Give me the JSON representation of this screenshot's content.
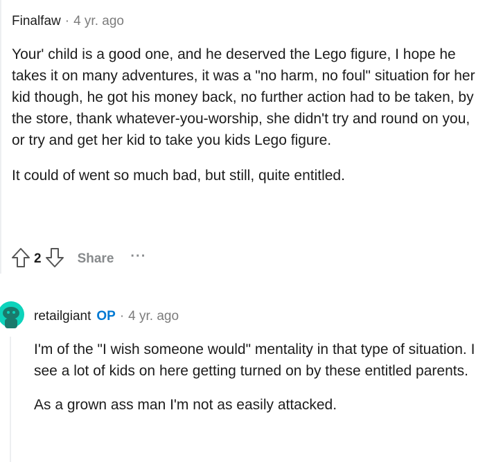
{
  "top_comment": {
    "username": "Finalfaw",
    "separator": "·",
    "time": "4 yr. ago",
    "paragraphs": [
      "Your' child is a good one, and he deserved the Lego figure, I hope he takes it on many adventures, it was a \"no harm, no foul\" situation for her kid though, he got his money back, no further action had to be taken, by the store, thank whatever-you-worship, she didn't try and round on you, or try and get her kid to take you kids Lego figure.",
      "It could of went so much bad, but still, quite entitled."
    ],
    "actions": {
      "upvote_icon": "upvote-arrow-icon",
      "vote_count": "2",
      "downvote_icon": "downvote-arrow-icon",
      "share_label": "Share",
      "more_label": "···"
    }
  },
  "reply_comment": {
    "avatar_icon": "snoo-avatar-icon",
    "username": "retailgiant",
    "op_badge": "OP",
    "separator": "·",
    "time": "4 yr. ago",
    "paragraphs": [
      "I'm of the \"I wish someone would\" mentality in that type of situation. I see a lot of kids on here getting turned on by these entitled parents.",
      "As a grown ass man I'm not as easily attacked."
    ]
  },
  "colors": {
    "text": "#1c1c1c",
    "meta": "#7c7c7c",
    "op": "#0079d3",
    "action": "#878a8c",
    "avatar": "#0dd3bb",
    "thread_line": "#edeff1"
  }
}
